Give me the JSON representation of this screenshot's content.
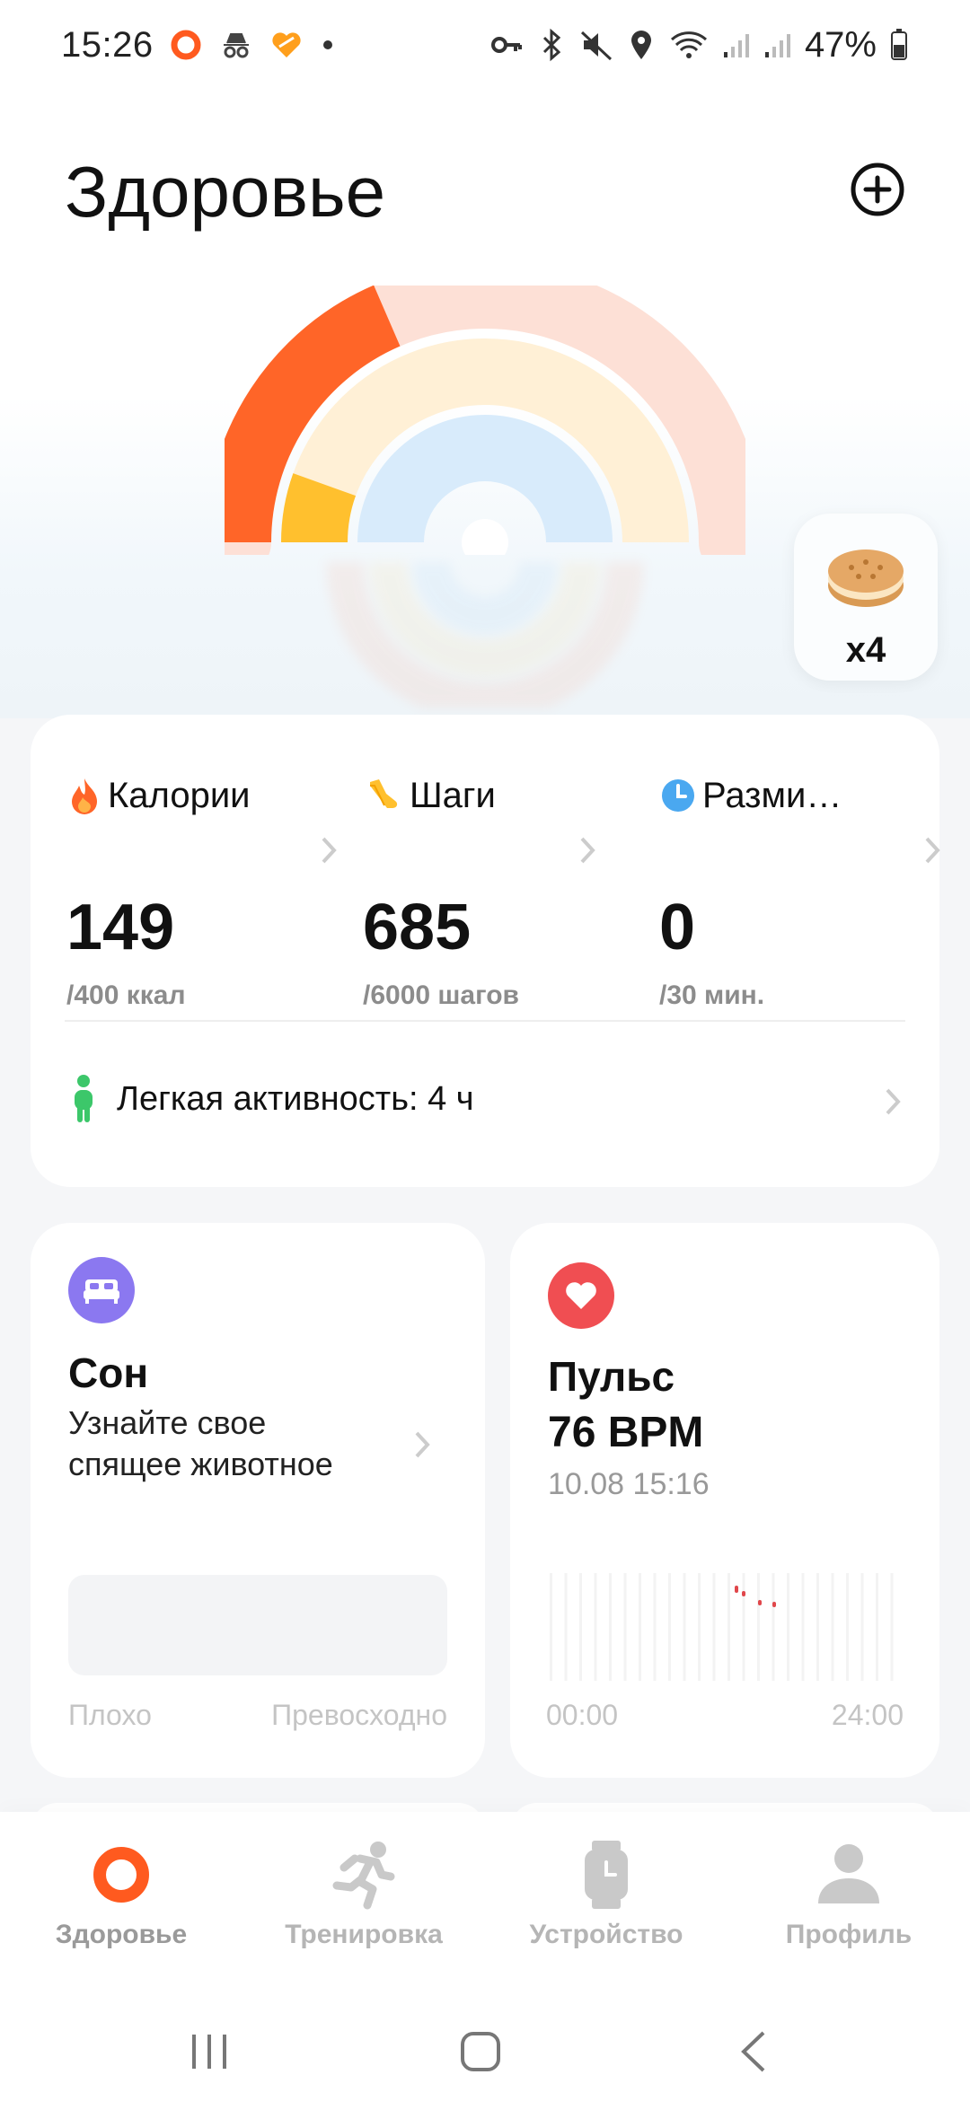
{
  "status_bar": {
    "time": "15:26",
    "battery": "47%"
  },
  "header": {
    "title": "Здоровье"
  },
  "rings_data": {
    "calories_fraction": 0.37,
    "steps_fraction": 0.11,
    "warmup_fraction": 0.0
  },
  "reward": {
    "count": "x4",
    "icon": "cookie-icon"
  },
  "stats": {
    "calories": {
      "label": "Калории",
      "value": "149",
      "goal": "/400 ккал",
      "color": "#ff6528"
    },
    "steps": {
      "label": "Шаги",
      "value": "685",
      "goal": "/6000 шагов",
      "color": "#ffc02e"
    },
    "warmup": {
      "label": "Разми…",
      "value": "0",
      "goal": "/30 мин.",
      "color": "#4aa8f0"
    },
    "activity": {
      "label": "Легкая активность: 4 ч"
    }
  },
  "sleep": {
    "title": "Сон",
    "subtitle_line1": "Узнайте свое",
    "subtitle_line2": "спящее животное",
    "axis_left": "Плохо",
    "axis_right": "Превосходно"
  },
  "pulse": {
    "title": "Пульс",
    "value": "76 BPM",
    "timestamp": "10.08 15:16",
    "axis_left": "00:00",
    "axis_right": "24:00"
  },
  "tabs": [
    {
      "label": "Здоровье",
      "icon": "health-ring-icon",
      "active": true
    },
    {
      "label": "Тренировка",
      "icon": "running-icon",
      "active": false
    },
    {
      "label": "Устройство",
      "icon": "watch-icon",
      "active": false
    },
    {
      "label": "Профиль",
      "icon": "person-icon",
      "active": false
    }
  ]
}
